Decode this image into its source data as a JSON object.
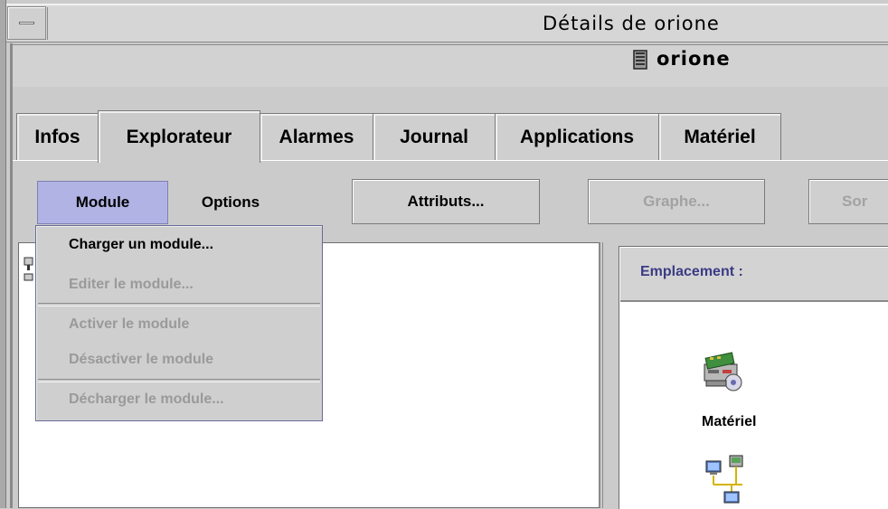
{
  "window": {
    "title": "Détails de orione"
  },
  "host": {
    "name": "orione",
    "icon": "server-icon"
  },
  "tabs": [
    {
      "label": "Infos",
      "active": false
    },
    {
      "label": "Explorateur",
      "active": true
    },
    {
      "label": "Alarmes",
      "active": false
    },
    {
      "label": "Journal",
      "active": false
    },
    {
      "label": "Applications",
      "active": false
    },
    {
      "label": "Matériel",
      "active": false
    }
  ],
  "toolbar": {
    "menu_module": "Module",
    "menu_options": "Options",
    "attributes_button": "Attributs...",
    "graph_button": "Graphe...",
    "exit_button": "Sor"
  },
  "module_menu": {
    "items": [
      {
        "label": "Charger un module...",
        "enabled": true
      },
      {
        "label": "Editer le module...",
        "enabled": false
      },
      {
        "label": "Activer le module",
        "enabled": false
      },
      {
        "label": "Désactiver le module",
        "enabled": false
      },
      {
        "label": "Décharger le module...",
        "enabled": false
      }
    ]
  },
  "right_pane": {
    "location_label": "Emplacement :",
    "items": [
      {
        "label": "Matériel",
        "icon": "hardware-icon"
      },
      {
        "label": "",
        "icon": "network-icon"
      }
    ]
  },
  "colors": {
    "menu_highlight": "#b0b3e3",
    "location_text": "#3b3b86",
    "disabled_text": "#9a9a9a"
  }
}
